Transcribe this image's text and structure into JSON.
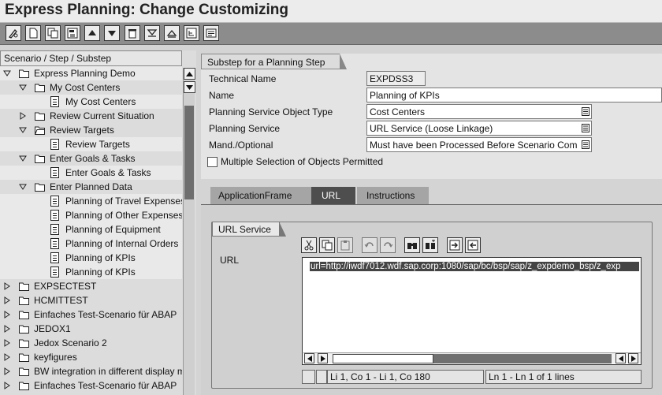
{
  "window": {
    "title": "Express Planning: Change Customizing"
  },
  "toolbar": {
    "buttons": [
      {
        "name": "change-display-button",
        "icon": "pencil-glasses-icon"
      },
      {
        "name": "create-button",
        "icon": "new-document-icon"
      },
      {
        "name": "copy-button",
        "icon": "copy-icon"
      },
      {
        "name": "save-as-button",
        "icon": "save-icon"
      },
      {
        "name": "move-up-button",
        "icon": "triangle-up-icon"
      },
      {
        "name": "move-down-button",
        "icon": "triangle-down-icon"
      },
      {
        "name": "delete-button",
        "icon": "trash-icon"
      },
      {
        "name": "expand-button",
        "icon": "expand-icon"
      },
      {
        "name": "collapse-button",
        "icon": "collapse-icon"
      },
      {
        "name": "add-node-button",
        "icon": "tree-add-icon"
      },
      {
        "name": "details-button",
        "icon": "details-icon"
      }
    ]
  },
  "tree": {
    "header": "Scenario / Step / Substep",
    "rows": [
      {
        "label": "Express Planning Demo",
        "level": 0,
        "type": "folder",
        "state": "open",
        "highlight": true
      },
      {
        "label": "My Cost Centers",
        "level": 1,
        "type": "folder",
        "state": "open",
        "highlight": false
      },
      {
        "label": "My Cost Centers",
        "level": 2,
        "type": "doc",
        "highlight": true
      },
      {
        "label": "Review Current Situation",
        "level": 1,
        "type": "folder",
        "state": "closed",
        "highlight": false
      },
      {
        "label": "Review Targets",
        "level": 1,
        "type": "folder-open",
        "state": "open",
        "highlight": false
      },
      {
        "label": "Review Targets",
        "level": 2,
        "type": "doc",
        "highlight": true
      },
      {
        "label": "Enter Goals & Tasks",
        "level": 1,
        "type": "folder",
        "state": "open",
        "highlight": false
      },
      {
        "label": "Enter Goals & Tasks",
        "level": 2,
        "type": "doc",
        "highlight": true
      },
      {
        "label": "Enter Planned Data",
        "level": 1,
        "type": "folder",
        "state": "open",
        "highlight": false
      },
      {
        "label": "Planning of Travel Expenses",
        "level": 2,
        "type": "doc",
        "highlight": true
      },
      {
        "label": "Planning of Other Expenses",
        "level": 2,
        "type": "doc",
        "highlight": true
      },
      {
        "label": "Planning of Equipment",
        "level": 2,
        "type": "doc",
        "highlight": true
      },
      {
        "label": "Planning of Internal Orders",
        "level": 2,
        "type": "doc",
        "highlight": true
      },
      {
        "label": "Planning of KPIs",
        "level": 2,
        "type": "doc",
        "highlight": true
      },
      {
        "label": "Planning of KPIs",
        "level": 2,
        "type": "doc",
        "highlight": true
      },
      {
        "label": "EXPSECTEST",
        "level": 0,
        "type": "folder",
        "state": "closed",
        "highlight": false
      },
      {
        "label": "HCMITTEST",
        "level": 0,
        "type": "folder",
        "state": "closed",
        "highlight": false
      },
      {
        "label": "Einfaches Test-Scenario für ABAP",
        "level": 0,
        "type": "folder",
        "state": "closed",
        "highlight": false
      },
      {
        "label": "JEDOX1",
        "level": 0,
        "type": "folder",
        "state": "closed",
        "highlight": false
      },
      {
        "label": "Jedox Scenario 2",
        "level": 0,
        "type": "folder",
        "state": "closed",
        "highlight": false
      },
      {
        "label": "keyfigures",
        "level": 0,
        "type": "folder",
        "state": "closed",
        "highlight": false
      },
      {
        "label": "BW integration in different display mo",
        "level": 0,
        "type": "folder",
        "state": "closed",
        "highlight": false
      },
      {
        "label": "Einfaches Test-Scenario für ABAP",
        "level": 0,
        "type": "folder",
        "state": "closed",
        "highlight": false
      }
    ]
  },
  "detail": {
    "panel_title": "Substep for a Planning Step",
    "fields": {
      "technical_name": {
        "label": "Technical Name",
        "value": "EXPDSS3"
      },
      "name": {
        "label": "Name",
        "value": "Planning of KPIs"
      },
      "object_type": {
        "label": "Planning Service Object Type",
        "value": "Cost Centers"
      },
      "service": {
        "label": "Planning Service",
        "value": "URL Service (Loose Linkage)"
      },
      "mandatory": {
        "label": "Mand./Optional",
        "value": "Must have been Processed Before Scenario Com"
      }
    },
    "multiple_selection": {
      "label": "Multiple Selection of Objects Permitted",
      "checked": false
    }
  },
  "tabs": [
    {
      "label": "ApplicationFrame",
      "active": false
    },
    {
      "label": "URL",
      "active": true
    },
    {
      "label": "Instructions",
      "active": false
    }
  ],
  "url_service": {
    "group_title": "URL Service",
    "url_label": "URL",
    "editor_text": "url=http://iwdf7012.wdf.sap.corp:1080/sap/bc/bsp/sap/z_expdemo_bsp/z_exp",
    "status_left": "Li 1, Co 1 - Li 1, Co 180",
    "status_right": "Ln 1 - Ln 1 of 1 lines"
  }
}
